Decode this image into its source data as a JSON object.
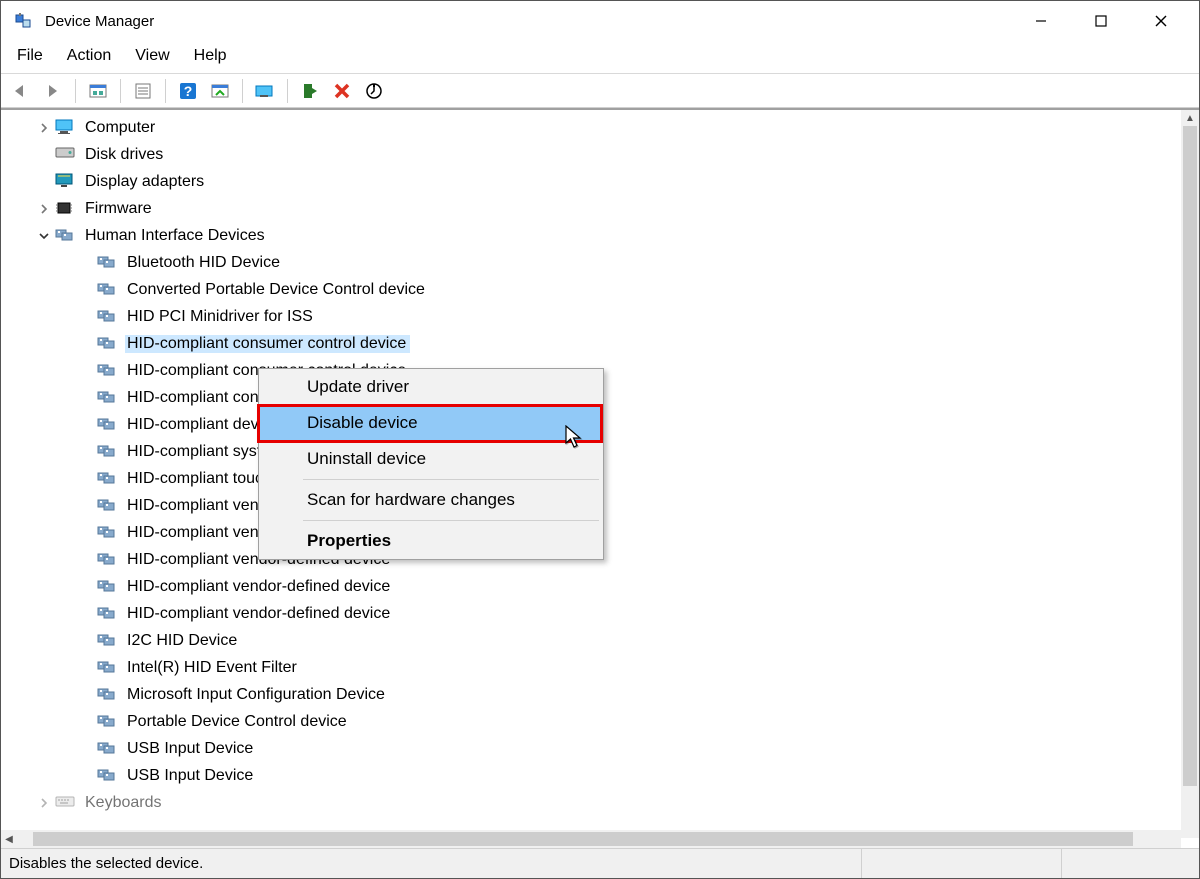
{
  "window": {
    "title": "Device Manager"
  },
  "menubar": {
    "file": "File",
    "action": "Action",
    "view": "View",
    "help": "Help"
  },
  "toolbar": {
    "back": "Back",
    "forward": "Forward",
    "show_hide": "Show/Hide Console Tree",
    "properties": "Properties",
    "help": "Help",
    "show_hidden": "Show hidden devices",
    "scan": "Scan for hardware changes",
    "enable": "Enable device",
    "uninstall": "Uninstall device",
    "update": "Update driver"
  },
  "tree": {
    "items": [
      {
        "label": "Computer",
        "icon": "monitor",
        "collapsed": true,
        "level": 1
      },
      {
        "label": "Disk drives",
        "icon": "disk",
        "collapsed": false,
        "level": 1
      },
      {
        "label": "Display adapters",
        "icon": "display",
        "collapsed": false,
        "level": 1
      },
      {
        "label": "Firmware",
        "icon": "chip",
        "collapsed": true,
        "level": 1
      },
      {
        "label": "Human Interface Devices",
        "icon": "hid",
        "expanded": true,
        "level": 1
      },
      {
        "label": "Bluetooth HID Device",
        "icon": "hid",
        "level": 2
      },
      {
        "label": "Converted Portable Device Control device",
        "icon": "hid",
        "level": 2
      },
      {
        "label": "HID PCI Minidriver for ISS",
        "icon": "hid",
        "level": 2
      },
      {
        "label": "HID-compliant consumer control device",
        "icon": "hid",
        "level": 2,
        "selected": true
      },
      {
        "label": "HID-compliant consumer control device",
        "icon": "hid",
        "level": 2
      },
      {
        "label": "HID-compliant consumer control device",
        "icon": "hid",
        "level": 2
      },
      {
        "label": "HID-compliant device",
        "icon": "hid",
        "level": 2
      },
      {
        "label": "HID-compliant system controller",
        "icon": "hid",
        "level": 2
      },
      {
        "label": "HID-compliant touch screen",
        "icon": "hid",
        "level": 2
      },
      {
        "label": "HID-compliant vendor-defined device",
        "icon": "hid",
        "level": 2
      },
      {
        "label": "HID-compliant vendor-defined device",
        "icon": "hid",
        "level": 2
      },
      {
        "label": "HID-compliant vendor-defined device",
        "icon": "hid",
        "level": 2
      },
      {
        "label": "HID-compliant vendor-defined device",
        "icon": "hid",
        "level": 2
      },
      {
        "label": "HID-compliant vendor-defined device",
        "icon": "hid",
        "level": 2
      },
      {
        "label": "I2C HID Device",
        "icon": "hid",
        "level": 2
      },
      {
        "label": "Intel(R) HID Event Filter",
        "icon": "hid",
        "level": 2
      },
      {
        "label": "Microsoft Input Configuration Device",
        "icon": "hid",
        "level": 2
      },
      {
        "label": "Portable Device Control device",
        "icon": "hid",
        "level": 2
      },
      {
        "label": "USB Input Device",
        "icon": "hid",
        "level": 2
      },
      {
        "label": "USB Input Device",
        "icon": "hid",
        "level": 2
      },
      {
        "label": "Keyboards",
        "icon": "keyboard",
        "collapsed": true,
        "level": 1,
        "partial": true
      }
    ]
  },
  "context_menu": {
    "items": [
      {
        "label": "Update driver"
      },
      {
        "label": "Disable device",
        "highlight": true,
        "redbox": true
      },
      {
        "label": "Uninstall device"
      },
      {
        "separator": true
      },
      {
        "label": "Scan for hardware changes"
      },
      {
        "separator": true
      },
      {
        "label": "Properties",
        "bold": true
      }
    ]
  },
  "statusbar": {
    "text": "Disables the selected device."
  }
}
